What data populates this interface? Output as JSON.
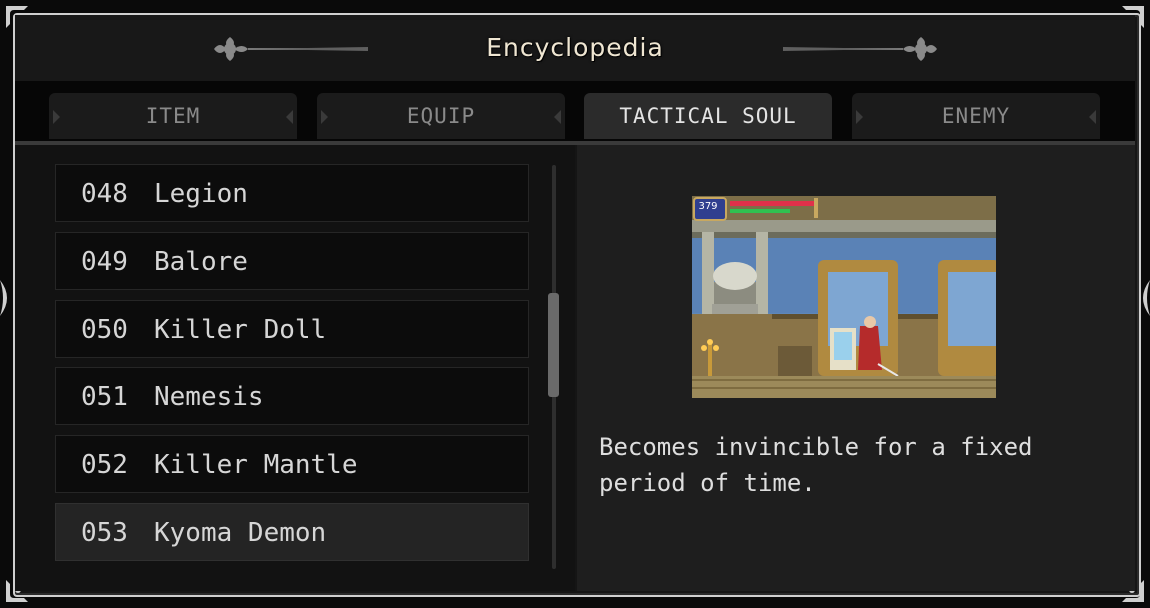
{
  "header": {
    "title": "Encyclopedia"
  },
  "tabs": [
    {
      "label": "ITEM",
      "active": false
    },
    {
      "label": "EQUIP",
      "active": false
    },
    {
      "label": "TACTICAL SOUL",
      "active": true
    },
    {
      "label": "ENEMY",
      "active": false
    }
  ],
  "list": {
    "rows": [
      {
        "num": "048",
        "name": "Legion"
      },
      {
        "num": "049",
        "name": "Balore"
      },
      {
        "num": "050",
        "name": "Killer Doll"
      },
      {
        "num": "051",
        "name": "Nemesis"
      },
      {
        "num": "052",
        "name": "Killer Mantle"
      },
      {
        "num": "053",
        "name": "Kyoma Demon"
      }
    ],
    "selected_index": 5
  },
  "detail": {
    "hud_hp": "379",
    "description": "Becomes invincible for a fixed period of time."
  },
  "colors": {
    "frame_border": "#cfcfcf",
    "title_text": "#efe6d2",
    "active_tab": "#2b2b2b",
    "inactive_tab": "#1b1b1b"
  }
}
